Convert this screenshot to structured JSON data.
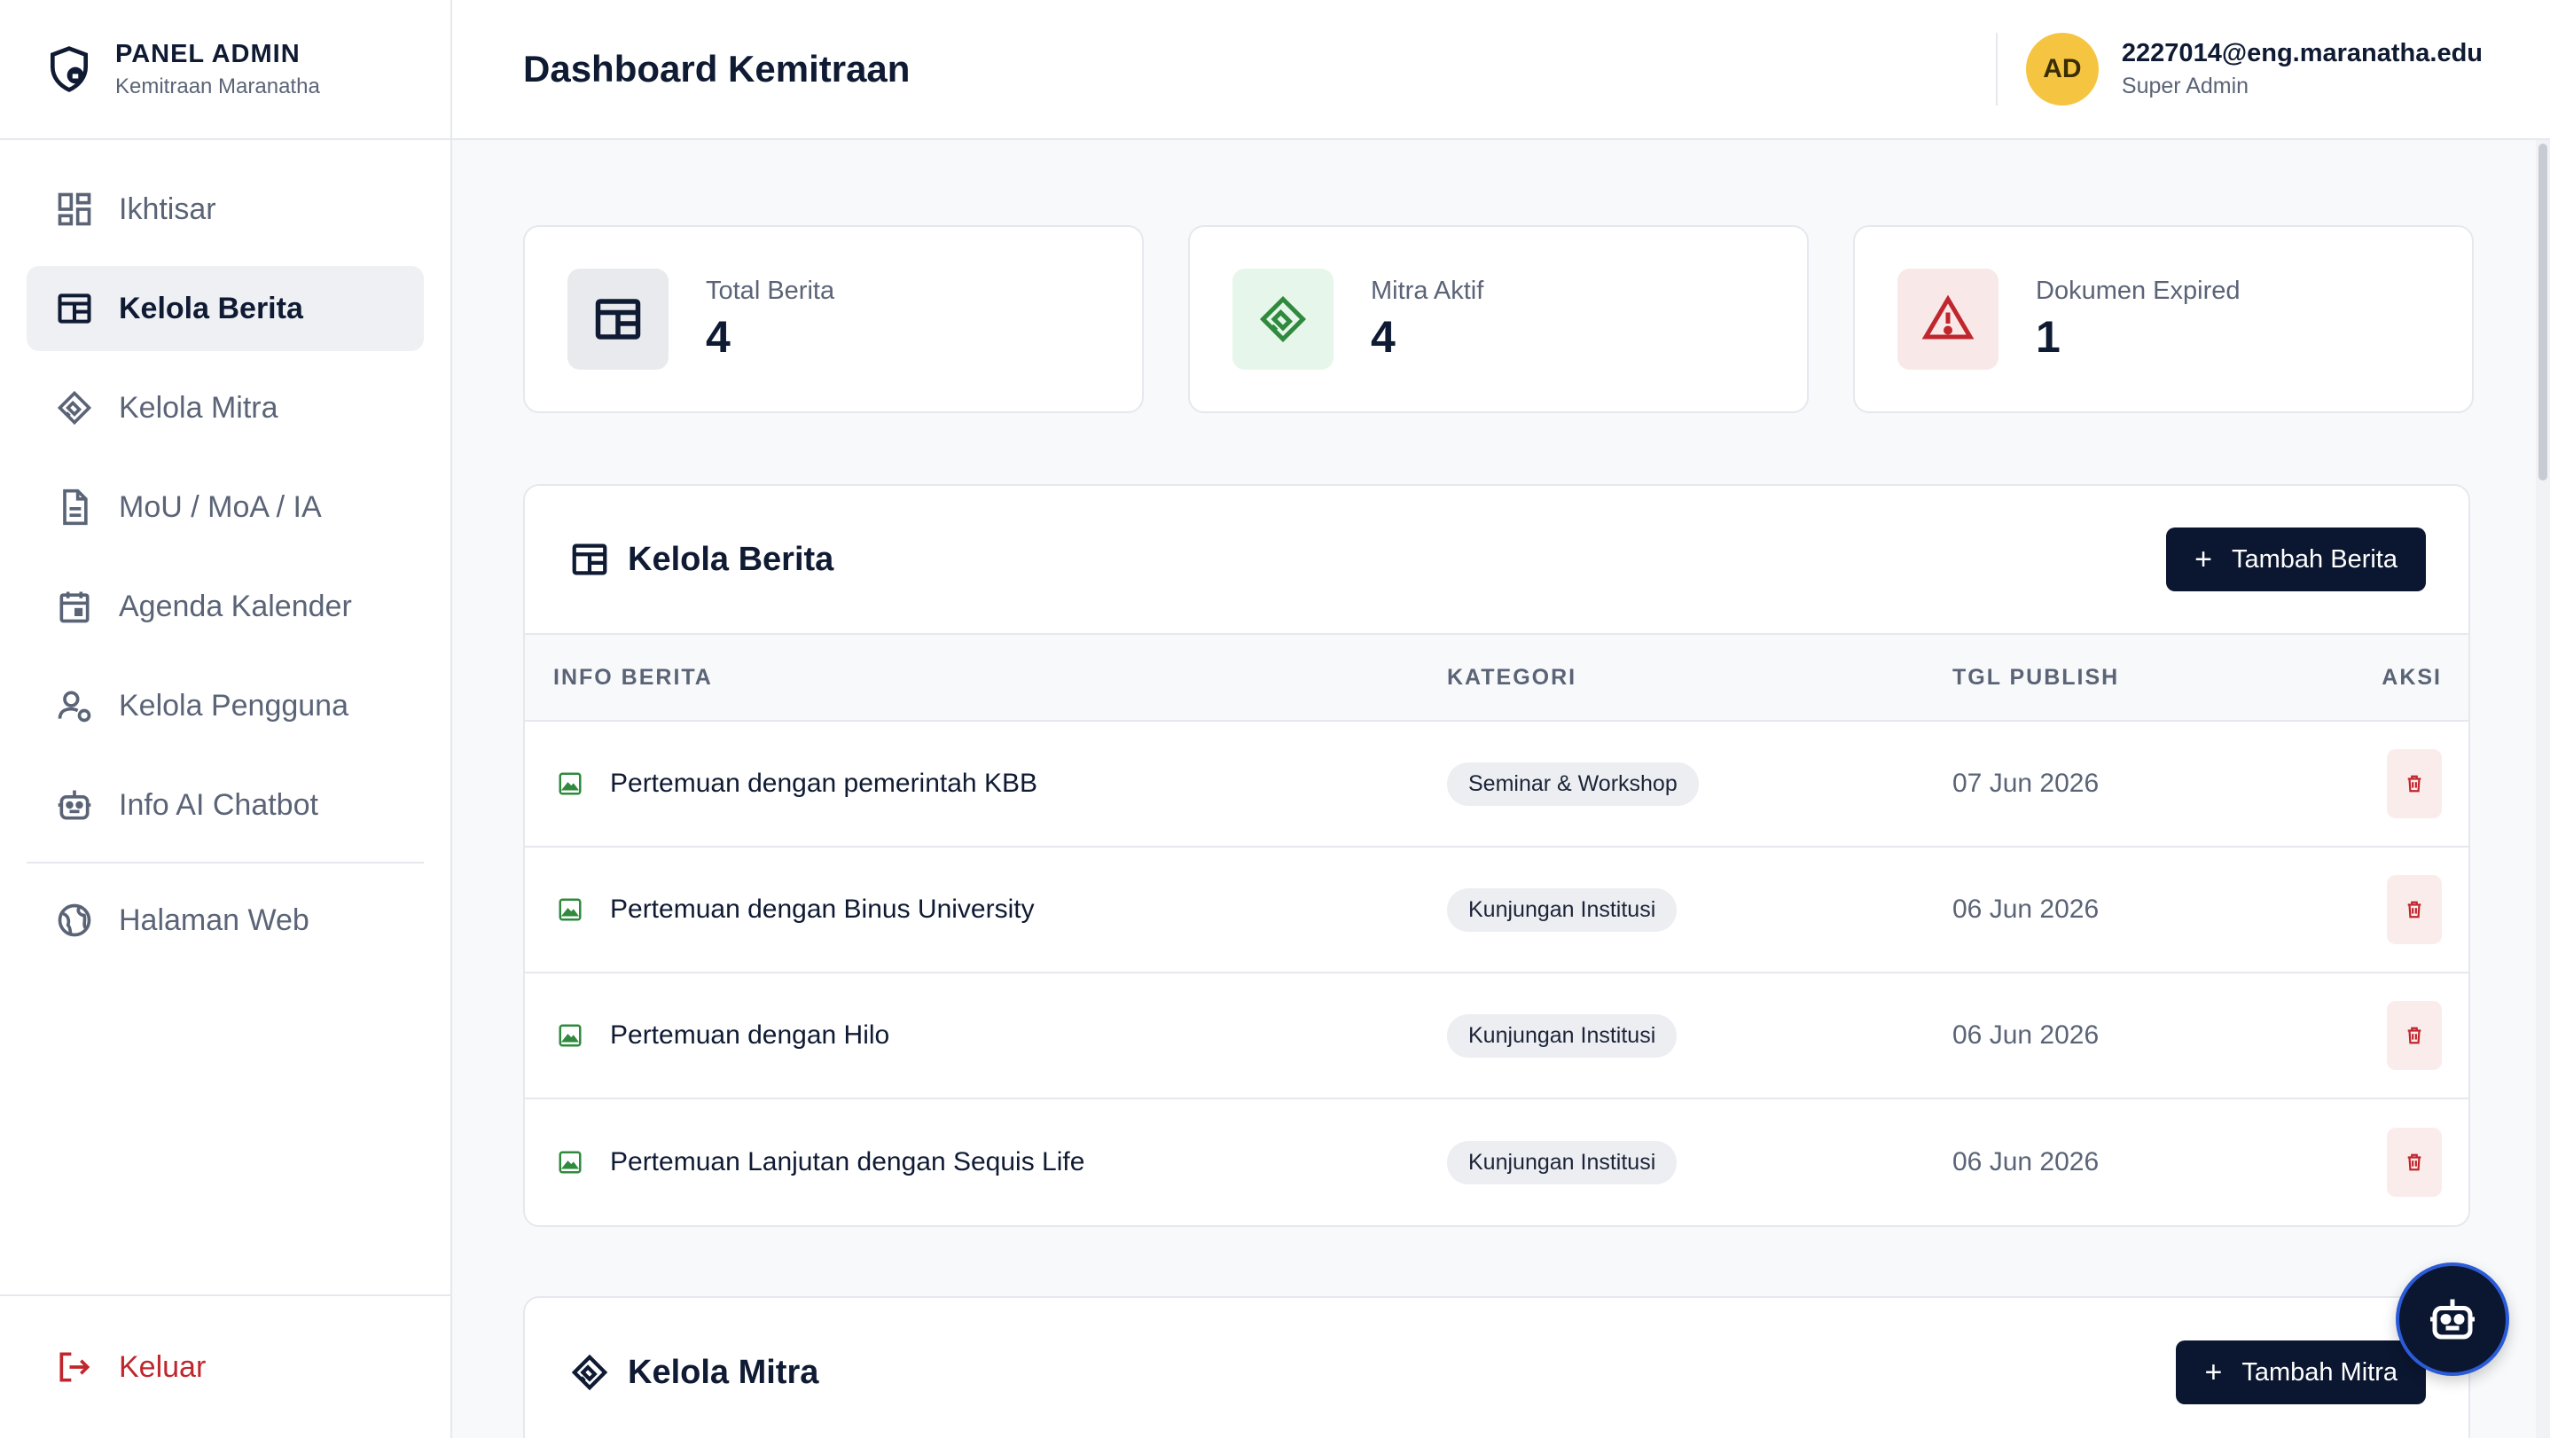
{
  "brand": {
    "title": "PANEL ADMIN",
    "subtitle": "Kemitraan Maranatha"
  },
  "sidebar": {
    "items": [
      {
        "label": "Ikhtisar",
        "icon": "dashboard-icon",
        "active": false
      },
      {
        "label": "Kelola Berita",
        "icon": "newspaper-icon",
        "active": true
      },
      {
        "label": "Kelola Mitra",
        "icon": "handshake-icon",
        "active": false
      },
      {
        "label": "MoU / MoA / IA",
        "icon": "document-icon",
        "active": false
      },
      {
        "label": "Agenda Kalender",
        "icon": "calendar-icon",
        "active": false
      },
      {
        "label": "Kelola Pengguna",
        "icon": "user-settings-icon",
        "active": false
      },
      {
        "label": "Info AI Chatbot",
        "icon": "robot-icon",
        "active": false
      }
    ],
    "web_link": {
      "label": "Halaman Web",
      "icon": "globe-icon"
    },
    "logout": {
      "label": "Keluar",
      "icon": "logout-icon"
    }
  },
  "header": {
    "title": "Dashboard Kemitraan",
    "user": {
      "initials": "AD",
      "email": "2227014@eng.maranatha.edu",
      "role": "Super Admin"
    }
  },
  "stats": [
    {
      "label": "Total Berita",
      "value": "4",
      "icon": "newspaper-icon",
      "bg": "#e8eaee",
      "color": "#0f1a33"
    },
    {
      "label": "Mitra Aktif",
      "value": "4",
      "icon": "handshake-icon",
      "bg": "#e6f6ea",
      "color": "#2f8a3e"
    },
    {
      "label": "Dokumen Expired",
      "value": "1",
      "icon": "warning-icon",
      "bg": "#f8e8e8",
      "color": "#c0262d"
    }
  ],
  "berita_panel": {
    "title": "Kelola Berita",
    "add_button": "Tambah Berita",
    "columns": [
      "INFO BERITA",
      "KATEGORI",
      "TGL PUBLISH",
      "AKSI"
    ],
    "rows": [
      {
        "title": "Pertemuan dengan pemerintah KBB",
        "category": "Seminar & Workshop",
        "date": "07 Jun 2026"
      },
      {
        "title": "Pertemuan dengan Binus University",
        "category": "Kunjungan Institusi",
        "date": "06 Jun 2026"
      },
      {
        "title": "Pertemuan dengan Hilo",
        "category": "Kunjungan Institusi",
        "date": "06 Jun 2026"
      },
      {
        "title": "Pertemuan Lanjutan dengan Sequis Life",
        "category": "Kunjungan Institusi",
        "date": "06 Jun 2026"
      }
    ]
  },
  "mitra_panel": {
    "title": "Kelola Mitra",
    "add_button": "Tambah Mitra"
  },
  "colors": {
    "primary": "#0b1630",
    "danger": "#c0262d",
    "success": "#2f8a3e",
    "avatar": "#f5c542"
  }
}
